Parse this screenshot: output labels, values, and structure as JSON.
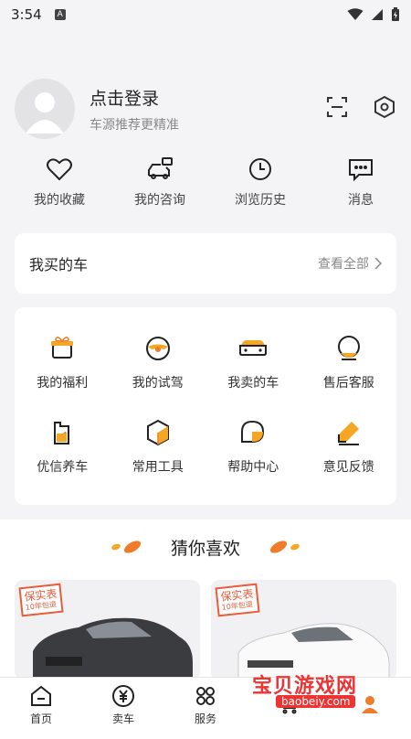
{
  "status_bar": {
    "time": "3:54",
    "notif_letter": "A"
  },
  "profile": {
    "login_title": "点击登录",
    "login_subtitle": "车源推荐更精准",
    "scan_icon": "scan-icon",
    "settings_icon": "settings-hex-icon"
  },
  "quick_actions": [
    {
      "icon": "heart-icon",
      "label": "我的收藏"
    },
    {
      "icon": "car-chat-icon",
      "label": "我的咨询"
    },
    {
      "icon": "clock-icon",
      "label": "浏览历史"
    },
    {
      "icon": "message-icon",
      "label": "消息"
    }
  ],
  "my_car": {
    "title": "我买的车",
    "more_label": "查看全部"
  },
  "services": [
    {
      "icon": "gift-icon",
      "label": "我的福利"
    },
    {
      "icon": "steering-wheel-icon",
      "label": "我的试驾"
    },
    {
      "icon": "car-front-icon",
      "label": "我卖的车"
    },
    {
      "icon": "customer-service-icon",
      "label": "售后客服"
    },
    {
      "icon": "oil-can-icon",
      "label": "优信养车"
    },
    {
      "icon": "cube-tool-icon",
      "label": "常用工具"
    },
    {
      "icon": "chat-bubble-icon",
      "label": "帮助中心"
    },
    {
      "icon": "pencil-icon",
      "label": "意见反馈"
    }
  ],
  "guess": {
    "title": "猜你喜欢",
    "cards": [
      {
        "badge": "保实表",
        "badge_sub": "10年包退",
        "car_color": "#3a3c40"
      },
      {
        "badge": "保实表",
        "badge_sub": "10年包退",
        "car_color": "#f2f2f2"
      }
    ]
  },
  "tabbar": [
    {
      "icon": "home-icon",
      "label": "首页"
    },
    {
      "icon": "yuan-circle-icon",
      "label": "卖车"
    },
    {
      "icon": "grid-clover-icon",
      "label": "服务"
    },
    {
      "icon": "cart-icon",
      "label": ""
    },
    {
      "icon": "user-icon",
      "label": ""
    }
  ],
  "watermark": {
    "text": "宝贝游戏网",
    "url": "baobeiy.com"
  },
  "colors": {
    "accent": "#f5a623",
    "brand_orange": "#f07b2a",
    "background": "#f4f4f6"
  }
}
